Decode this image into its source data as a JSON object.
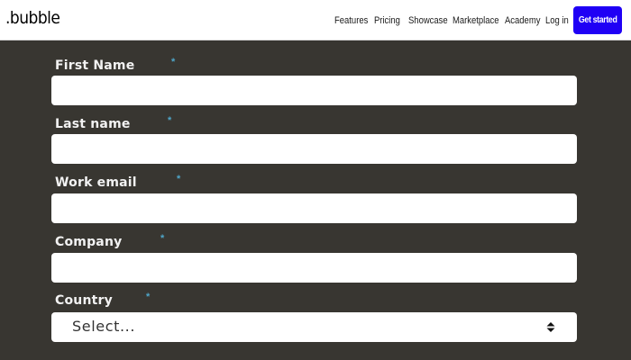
{
  "header": {
    "logo": ".bubble",
    "nav": {
      "features": "Features",
      "pricing": "Pricing",
      "showcase": "Showcase",
      "marketplace": "Marketplace",
      "academy": "Academy",
      "login": "Log in"
    },
    "cta": "Get started"
  },
  "form": {
    "required_marker": "*",
    "first_name": {
      "label": "First Name",
      "value": ""
    },
    "last_name": {
      "label": "Last name",
      "value": ""
    },
    "work_email": {
      "label": "Work email",
      "value": ""
    },
    "company": {
      "label": "Company",
      "value": ""
    },
    "country": {
      "label": "Country",
      "selected": "Select..."
    }
  },
  "colors": {
    "background": "#383631",
    "cta": "#1f00f5",
    "required": "#4fa6c9"
  }
}
